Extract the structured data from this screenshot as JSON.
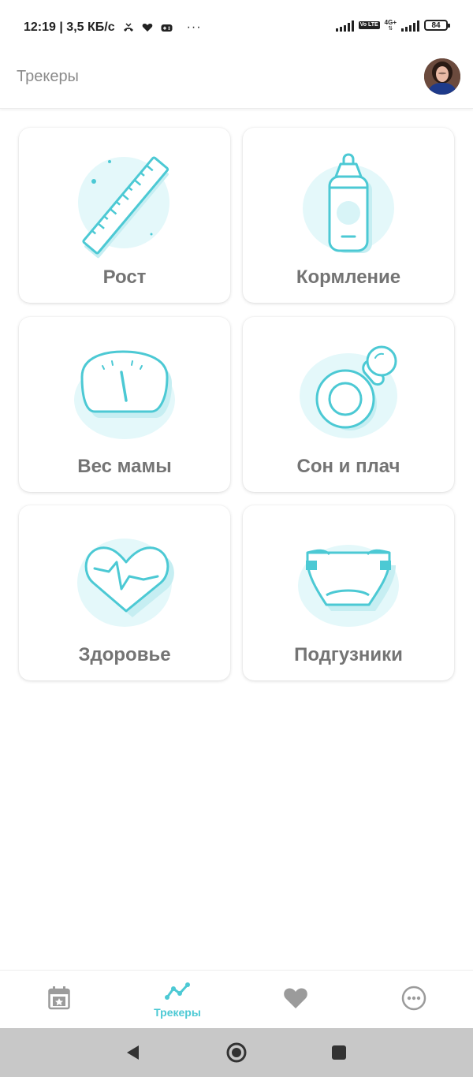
{
  "status_bar": {
    "time_speed": "12:19 | 3,5 КБ/с",
    "overflow": "···",
    "volte": "Vo LTE",
    "network": "4G+",
    "battery": "84"
  },
  "header": {
    "title": "Трекеры"
  },
  "trackers": [
    {
      "label": "Рост",
      "icon": "ruler-icon"
    },
    {
      "label": "Кормление",
      "icon": "baby-bottle-icon"
    },
    {
      "label": "Вес мамы",
      "icon": "scale-icon"
    },
    {
      "label": "Сон и плач",
      "icon": "pacifier-icon"
    },
    {
      "label": "Здоровье",
      "icon": "heart-pulse-icon"
    },
    {
      "label": "Подгузники",
      "icon": "diaper-icon"
    }
  ],
  "bottom_nav": {
    "items": [
      {
        "icon": "calendar-icon",
        "label": ""
      },
      {
        "icon": "chart-line-icon",
        "label": "Трекеры",
        "active": true
      },
      {
        "icon": "heart-icon",
        "label": ""
      },
      {
        "icon": "more-icon",
        "label": ""
      }
    ]
  },
  "colors": {
    "accent": "#4cc9d4",
    "accent_light": "#e4f8fa",
    "label_gray": "#747474",
    "icon_gray": "#9b9b9b"
  }
}
